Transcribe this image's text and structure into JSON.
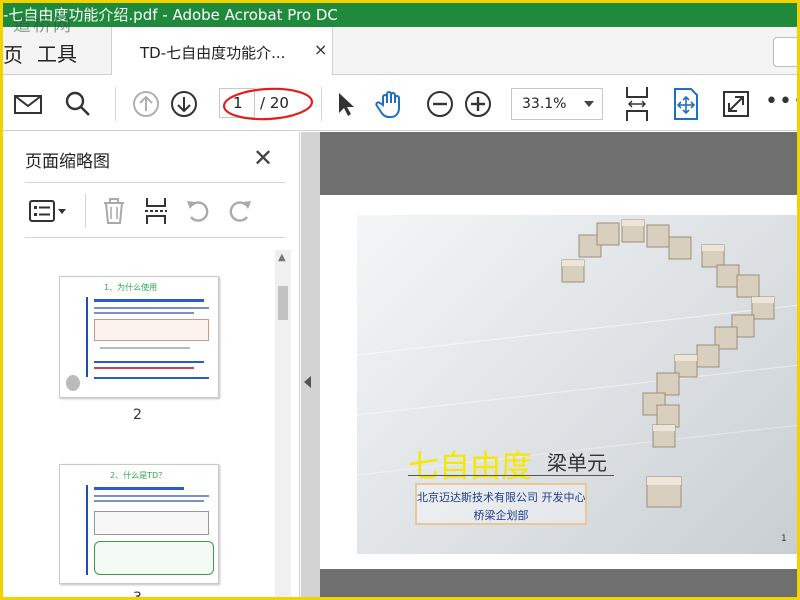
{
  "window": {
    "title": "-七自由度功能介绍.pdf - Adobe Acrobat Pro DC",
    "watermark": "道桥网"
  },
  "tabs": {
    "prev_partial": "页",
    "tools": "工具",
    "doc_tab": "TD-七自由度功能介...",
    "close_glyph": "×"
  },
  "toolbar": {
    "page_current": "1",
    "page_total": "/ 20",
    "zoom": "33.1%",
    "more_glyph": "•••"
  },
  "thumbnail_panel": {
    "title": "页面缩略图",
    "close_glyph": "✕",
    "thumbnails": [
      {
        "page_label": "2",
        "heading": "1、为什么使用"
      },
      {
        "page_label": "3",
        "heading": "2、什么是TD？"
      }
    ]
  },
  "document": {
    "slide_title_highlight": "七自由度",
    "slide_title_rest": "梁单元",
    "company": "北京迈达斯技术有限公司 开发中心",
    "department": "桥梁企划部",
    "page_number": "1"
  },
  "colors": {
    "frame_border": "#f2d300",
    "title_bar": "#1f8a3c",
    "accent_blue": "#1f6fc5",
    "annotation_red": "#e02020",
    "slide_title_yellow": "#f6e600",
    "slide_text_blue": "#1e3a8a"
  },
  "icons": [
    "mail-icon",
    "search-icon",
    "page-up-icon",
    "page-down-icon",
    "select-arrow-icon",
    "hand-tool-icon",
    "zoom-out-icon",
    "zoom-in-icon",
    "fit-width-icon",
    "fit-page-icon",
    "fullscreen-icon",
    "more-icon",
    "options-icon",
    "trash-icon",
    "insert-page-icon",
    "rotate-left-icon",
    "rotate-right-icon"
  ]
}
